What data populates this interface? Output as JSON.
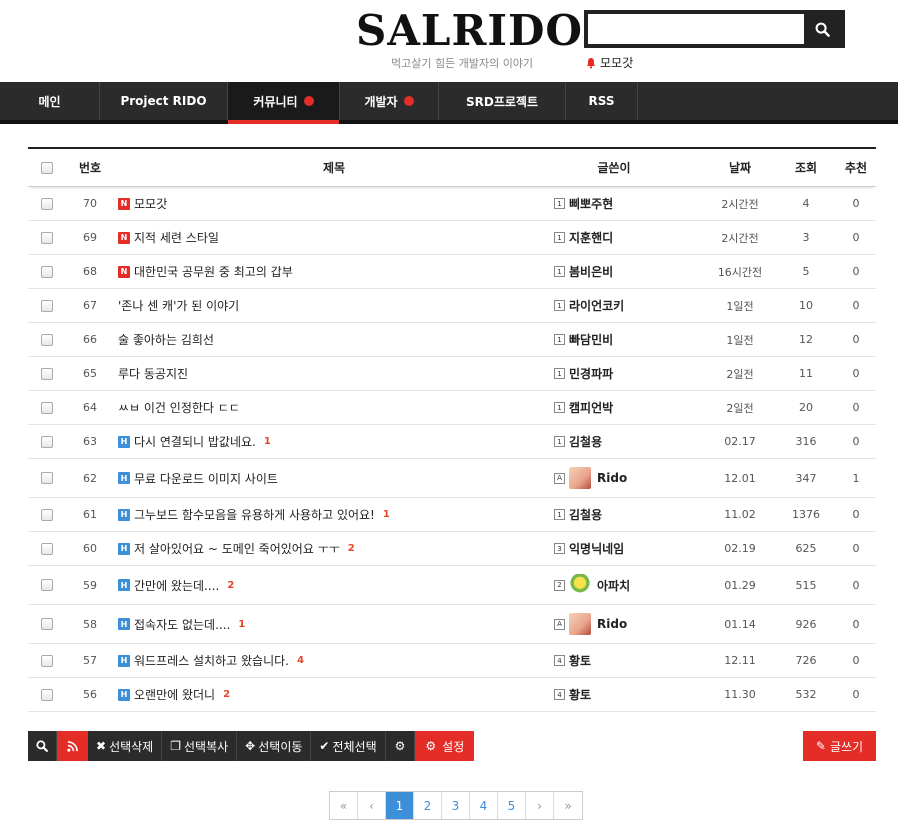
{
  "site": {
    "logo": "SALRIDO",
    "tagline": "먹고살기 힘든 개발자의 이야기",
    "search_placeholder": "",
    "user": "모모갓"
  },
  "nav": [
    {
      "label": "메인",
      "dot": false,
      "active": false
    },
    {
      "label": "Project RIDO",
      "dot": false,
      "active": false
    },
    {
      "label": "커뮤니티",
      "dot": true,
      "active": true
    },
    {
      "label": "개발자",
      "dot": true,
      "active": false
    },
    {
      "label": "SRD프로젝트",
      "dot": false,
      "active": false
    },
    {
      "label": "RSS",
      "dot": false,
      "active": false
    }
  ],
  "table": {
    "headers": {
      "num": "번호",
      "title": "제목",
      "writer": "글쓴이",
      "date": "날짜",
      "views": "조회",
      "rec": "추천"
    },
    "rows": [
      {
        "num": "70",
        "badge": "N",
        "title": "모모갓",
        "comments": "",
        "level": "1",
        "avatar": "",
        "writer": "삐뽀주현",
        "date": "2시간전",
        "views": "4",
        "rec": "0"
      },
      {
        "num": "69",
        "badge": "N",
        "title": "지적 세련 스타일",
        "comments": "",
        "level": "1",
        "avatar": "",
        "writer": "지훈핸디",
        "date": "2시간전",
        "views": "3",
        "rec": "0"
      },
      {
        "num": "68",
        "badge": "N",
        "title": "대한민국 공무원 중 최고의 갑부",
        "comments": "",
        "level": "1",
        "avatar": "",
        "writer": "봄비은비",
        "date": "16시간전",
        "views": "5",
        "rec": "0"
      },
      {
        "num": "67",
        "badge": "",
        "title": "'존나 센 캐'가 된 이야기",
        "comments": "",
        "level": "1",
        "avatar": "",
        "writer": "라이언코키",
        "date": "1일전",
        "views": "10",
        "rec": "0"
      },
      {
        "num": "66",
        "badge": "",
        "title": "술 좋아하는 김희선",
        "comments": "",
        "level": "1",
        "avatar": "",
        "writer": "빠담민비",
        "date": "1일전",
        "views": "12",
        "rec": "0"
      },
      {
        "num": "65",
        "badge": "",
        "title": "루다 동공지진",
        "comments": "",
        "level": "1",
        "avatar": "",
        "writer": "민경파파",
        "date": "2일전",
        "views": "11",
        "rec": "0"
      },
      {
        "num": "64",
        "badge": "",
        "title": "ㅆㅂ 이건 인정한다 ㄷㄷ",
        "comments": "",
        "level": "1",
        "avatar": "",
        "writer": "캠피언박",
        "date": "2일전",
        "views": "20",
        "rec": "0"
      },
      {
        "num": "63",
        "badge": "H",
        "title": "다시 연결되니 밥값네요.",
        "comments": "1",
        "level": "1",
        "avatar": "",
        "writer": "김철용",
        "date": "02.17",
        "views": "316",
        "rec": "0"
      },
      {
        "num": "62",
        "badge": "H",
        "title": "무료 다운로드 이미지 사이트",
        "comments": "",
        "level": "A",
        "avatar": "rido",
        "writer": "Rido",
        "date": "12.01",
        "views": "347",
        "rec": "1"
      },
      {
        "num": "61",
        "badge": "H",
        "title": "그누보드 함수모음을 유용하게 사용하고 있어요!",
        "comments": "1",
        "level": "1",
        "avatar": "",
        "writer": "김철용",
        "date": "11.02",
        "views": "1376",
        "rec": "0"
      },
      {
        "num": "60",
        "badge": "H",
        "title": "저 살아있어요 ~ 도메인 죽어있어요 ㅜㅜ",
        "comments": "2",
        "level": "3",
        "avatar": "",
        "writer": "익명닉네임",
        "date": "02.19",
        "views": "625",
        "rec": "0"
      },
      {
        "num": "59",
        "badge": "H",
        "title": "간만에 왔는데....",
        "comments": "2",
        "level": "2",
        "avatar": "apachi",
        "writer": "아파치",
        "date": "01.29",
        "views": "515",
        "rec": "0"
      },
      {
        "num": "58",
        "badge": "H",
        "title": "접속자도 없는데....",
        "comments": "1",
        "level": "A",
        "avatar": "rido",
        "writer": "Rido",
        "date": "01.14",
        "views": "926",
        "rec": "0"
      },
      {
        "num": "57",
        "badge": "H",
        "title": "워드프레스 설치하고 왔습니다.",
        "comments": "4",
        "level": "4",
        "avatar": "",
        "writer": "황토",
        "date": "12.11",
        "views": "726",
        "rec": "0"
      },
      {
        "num": "56",
        "badge": "H",
        "title": "오랜만에 왔더니",
        "comments": "2",
        "level": "4",
        "avatar": "",
        "writer": "황토",
        "date": "11.30",
        "views": "532",
        "rec": "0"
      }
    ]
  },
  "toolbar": {
    "delete": "선택삭제",
    "copy": "선택복사",
    "move": "선택이동",
    "select_all": "전체선택",
    "settings": "설정",
    "write": "글쓰기"
  },
  "pagination": {
    "first": "«",
    "prev": "‹",
    "pages": [
      "1",
      "2",
      "3",
      "4",
      "5"
    ],
    "current": "1",
    "next": "›",
    "last": "»"
  },
  "colors": {
    "accent": "#e52d27",
    "nav_bg": "#2b2b2b",
    "link_blue": "#3d8fd8",
    "comment": "#e5472b"
  }
}
